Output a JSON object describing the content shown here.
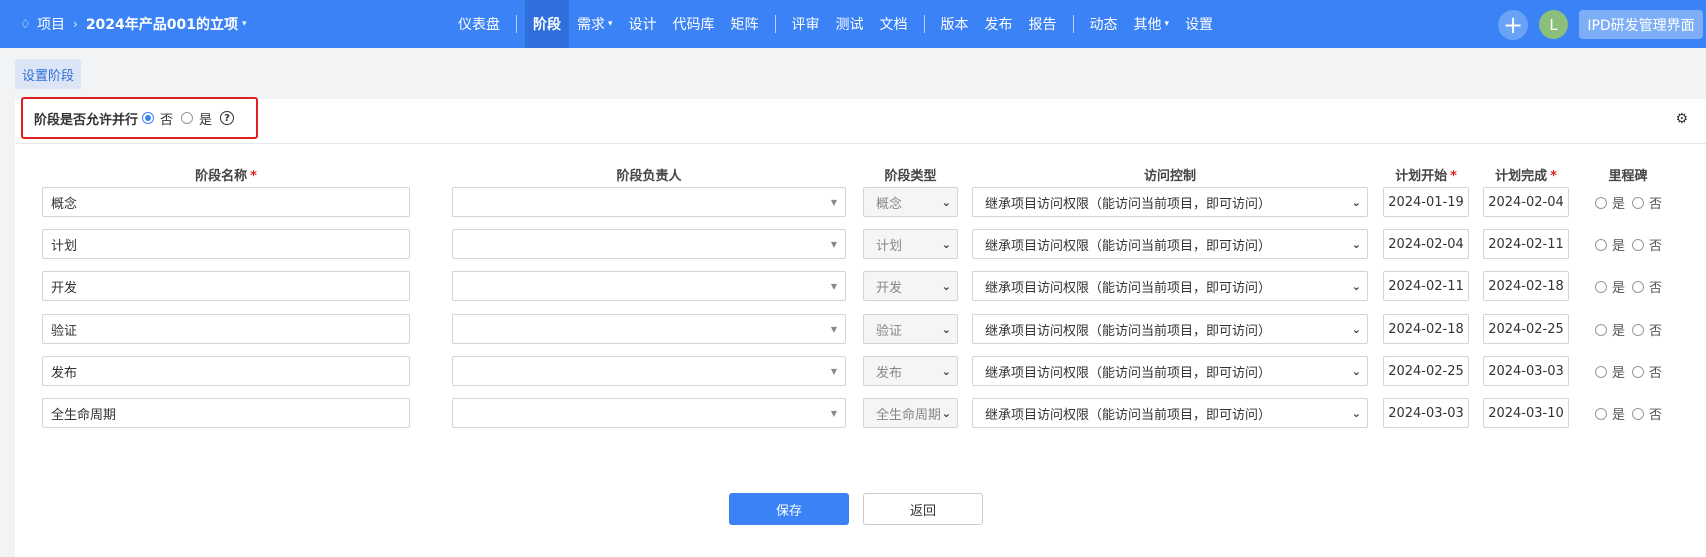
{
  "breadcrumb": {
    "root": "项目",
    "project": "2024年产品001的立项"
  },
  "nav": {
    "items": [
      {
        "label": "仪表盘"
      },
      {
        "label": "阶段",
        "active": true
      },
      {
        "label": "需求",
        "dropdown": true
      },
      {
        "label": "设计"
      },
      {
        "label": "代码库"
      },
      {
        "label": "矩阵"
      },
      {
        "label": "评审"
      },
      {
        "label": "测试"
      },
      {
        "label": "文档"
      },
      {
        "label": "版本"
      },
      {
        "label": "发布"
      },
      {
        "label": "报告"
      },
      {
        "label": "动态"
      },
      {
        "label": "其他",
        "dropdown": true
      },
      {
        "label": "设置"
      }
    ]
  },
  "user": {
    "avatar_letter": "L",
    "ipd_button": "IPD研发管理界面"
  },
  "page_tab": "设置阶段",
  "parallel": {
    "label": "阶段是否允许并行",
    "option_no": "否",
    "option_yes": "是",
    "selected": "否",
    "help": "?"
  },
  "table": {
    "headers": {
      "name": "阶段名称",
      "owner": "阶段负责人",
      "type": "阶段类型",
      "access": "访问控制",
      "start": "计划开始",
      "end": "计划完成",
      "milestone": "里程碑",
      "required_mark": "*"
    },
    "milestone_yes": "是",
    "milestone_no": "否",
    "rows": [
      {
        "name": "概念",
        "type": "概念",
        "access": "继承项目访问权限（能访问当前项目，即可访问）",
        "start": "2024-01-19",
        "end": "2024-02-04"
      },
      {
        "name": "计划",
        "type": "计划",
        "access": "继承项目访问权限（能访问当前项目，即可访问）",
        "start": "2024-02-04",
        "end": "2024-02-11"
      },
      {
        "name": "开发",
        "type": "开发",
        "access": "继承项目访问权限（能访问当前项目，即可访问）",
        "start": "2024-02-11",
        "end": "2024-02-18"
      },
      {
        "name": "验证",
        "type": "验证",
        "access": "继承项目访问权限（能访问当前项目，即可访问）",
        "start": "2024-02-18",
        "end": "2024-02-25"
      },
      {
        "name": "发布",
        "type": "发布",
        "access": "继承项目访问权限（能访问当前项目，即可访问）",
        "start": "2024-02-25",
        "end": "2024-03-03"
      },
      {
        "name": "全生命周期",
        "type": "全生命周期",
        "access": "继承项目访问权限（能访问当前项目，即可访问）",
        "start": "2024-03-03",
        "end": "2024-03-10"
      }
    ]
  },
  "buttons": {
    "save": "保存",
    "back": "返回"
  },
  "colors": {
    "primary": "#3b82f6",
    "required": "#e02020",
    "highlight_border": "#e02020"
  }
}
